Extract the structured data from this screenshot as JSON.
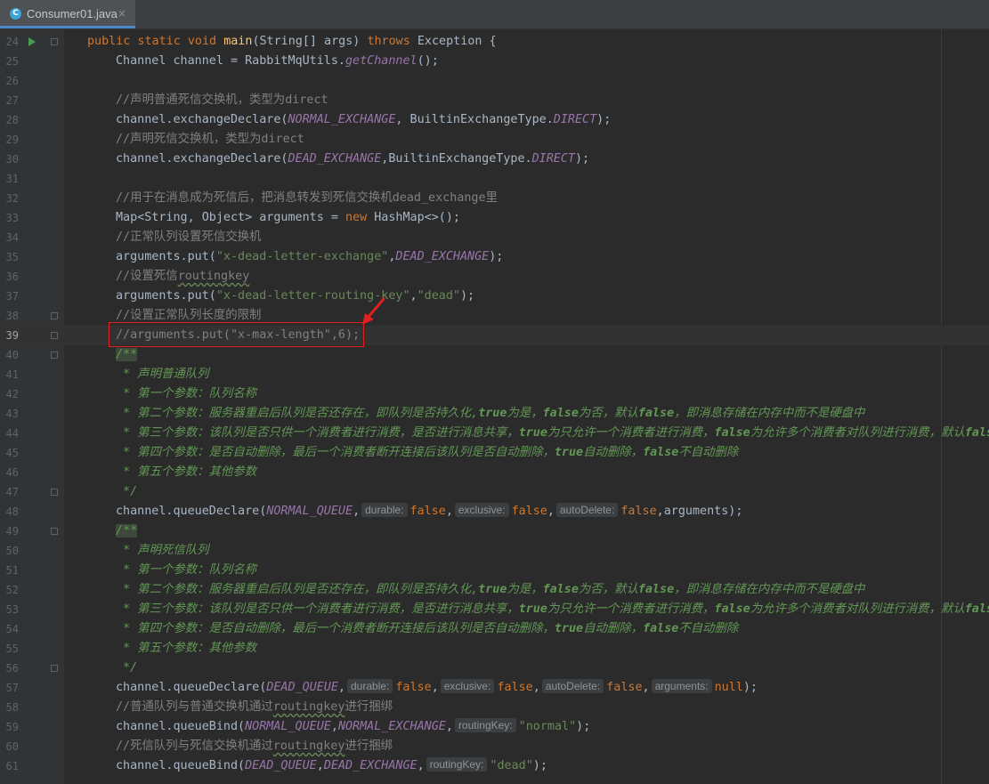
{
  "tab": {
    "icon": "java-class-icon",
    "icon_letter": "C",
    "filename": "Consumer01.java",
    "close": "×"
  },
  "editor": {
    "current_line": 39,
    "lines": [
      {
        "n": 24,
        "run": true,
        "fold": true,
        "indent": 0,
        "t": [
          [
            "kw",
            "public static void "
          ],
          [
            "fn",
            "main"
          ],
          [
            "",
            "(String[] args) "
          ],
          [
            "kw",
            "throws "
          ],
          [
            "",
            "Exception {"
          ]
        ]
      },
      {
        "n": 25,
        "indent": 1,
        "t": [
          [
            "",
            "Channel channel = RabbitMqUtils."
          ],
          [
            "st",
            "getChannel"
          ],
          [
            "",
            "();"
          ]
        ]
      },
      {
        "n": 26,
        "indent": 1,
        "t": []
      },
      {
        "n": 27,
        "indent": 1,
        "t": [
          [
            "cmt",
            "//声明普通死信交换机，类型为direct"
          ]
        ]
      },
      {
        "n": 28,
        "indent": 1,
        "t": [
          [
            "",
            "channel.exchangeDeclare("
          ],
          [
            "cst",
            "NORMAL_EXCHANGE"
          ],
          [
            "",
            ", BuiltinExchangeType."
          ],
          [
            "cst",
            "DIRECT"
          ],
          [
            "",
            ");"
          ]
        ]
      },
      {
        "n": 29,
        "indent": 1,
        "t": [
          [
            "cmt",
            "//声明死信交换机，类型为direct"
          ]
        ]
      },
      {
        "n": 30,
        "indent": 1,
        "t": [
          [
            "",
            "channel.exchangeDeclare("
          ],
          [
            "cst",
            "DEAD_EXCHANGE"
          ],
          [
            "",
            ",BuiltinExchangeType."
          ],
          [
            "cst",
            "DIRECT"
          ],
          [
            "",
            ");"
          ]
        ]
      },
      {
        "n": 31,
        "indent": 1,
        "t": []
      },
      {
        "n": 32,
        "indent": 1,
        "t": [
          [
            "cmt",
            "//用于在消息成为死信后，把消息转发到死信交换机dead_exchange里"
          ]
        ]
      },
      {
        "n": 33,
        "indent": 1,
        "t": [
          [
            "",
            "Map<String, Object> arguments = "
          ],
          [
            "kw",
            "new "
          ],
          [
            "",
            "HashMap<>();"
          ]
        ]
      },
      {
        "n": 34,
        "indent": 1,
        "t": [
          [
            "cmt",
            "//正常队列设置死信交换机"
          ]
        ]
      },
      {
        "n": 35,
        "indent": 1,
        "t": [
          [
            "",
            "arguments.put("
          ],
          [
            "str",
            "\"x-dead-letter-exchange\""
          ],
          [
            "",
            ","
          ],
          [
            "cst",
            "DEAD_EXCHANGE"
          ],
          [
            "",
            ");"
          ]
        ]
      },
      {
        "n": 36,
        "indent": 1,
        "t": [
          [
            "cmt",
            "//设置死信"
          ],
          [
            "cmt ul",
            "routingkey"
          ]
        ]
      },
      {
        "n": 37,
        "indent": 1,
        "t": [
          [
            "",
            "arguments.put("
          ],
          [
            "str",
            "\"x-dead-letter-routing-key\""
          ],
          [
            "",
            ","
          ],
          [
            "str",
            "\"dead\""
          ],
          [
            "",
            ");"
          ]
        ]
      },
      {
        "n": 38,
        "fold": true,
        "indent": 1,
        "t": [
          [
            "cmt",
            "//设置正常队列长度的限制"
          ]
        ]
      },
      {
        "n": 39,
        "fold": true,
        "indent": 1,
        "t": [
          [
            "cmt",
            "//arguments.put(\"x-max-length\",6);"
          ]
        ]
      },
      {
        "n": 40,
        "fold": true,
        "indent": 1,
        "t": [
          [
            "doc docstart",
            "/**"
          ]
        ]
      },
      {
        "n": 41,
        "indent": 1,
        "t": [
          [
            "doc",
            " * 声明普通队列"
          ]
        ]
      },
      {
        "n": 42,
        "indent": 1,
        "t": [
          [
            "doc",
            " * 第一个参数：队列名称"
          ]
        ]
      },
      {
        "n": 43,
        "indent": 1,
        "t": [
          [
            "doc",
            " * 第二个参数：服务器重启后队列是否还存在，即队列是否持久化,"
          ],
          [
            "doc b",
            "true"
          ],
          [
            "doc",
            "为是，"
          ],
          [
            "doc b",
            "false"
          ],
          [
            "doc",
            "为否，默认"
          ],
          [
            "doc b",
            "false"
          ],
          [
            "doc",
            "，即消息存储在内存中而不是硬盘中"
          ]
        ]
      },
      {
        "n": 44,
        "indent": 1,
        "t": [
          [
            "doc",
            " * 第三个参数：该队列是否只供一个消费者进行消费，是否进行消息共享，"
          ],
          [
            "doc b",
            "true"
          ],
          [
            "doc",
            "为只允许一个消费者进行消费，"
          ],
          [
            "doc b",
            "false"
          ],
          [
            "doc",
            "为允许多个消费者对队列进行消费，默认"
          ],
          [
            "doc b",
            "false"
          ]
        ]
      },
      {
        "n": 45,
        "indent": 1,
        "t": [
          [
            "doc",
            " * 第四个参数：是否自动删除，最后一个消费者断开连接后该队列是否自动删除，"
          ],
          [
            "doc b",
            "true"
          ],
          [
            "doc",
            "自动删除，"
          ],
          [
            "doc b",
            "false"
          ],
          [
            "doc",
            "不自动删除"
          ]
        ]
      },
      {
        "n": 46,
        "indent": 1,
        "t": [
          [
            "doc",
            " * 第五个参数：其他参数"
          ]
        ]
      },
      {
        "n": 47,
        "fold": true,
        "indent": 1,
        "t": [
          [
            "doc",
            " */"
          ]
        ]
      },
      {
        "n": 48,
        "indent": 1,
        "t": [
          [
            "",
            "channel.queueDeclare("
          ],
          [
            "cst",
            "NORMAL_QUEUE"
          ],
          [
            "",
            ","
          ],
          [
            "hint",
            "durable:"
          ],
          [
            "kw",
            "false"
          ],
          [
            "",
            ","
          ],
          [
            "hint",
            "exclusive:"
          ],
          [
            "kw",
            "false"
          ],
          [
            "",
            ","
          ],
          [
            "hint",
            "autoDelete:"
          ],
          [
            "kw",
            "false"
          ],
          [
            "",
            ",arguments);"
          ]
        ]
      },
      {
        "n": 49,
        "fold": true,
        "indent": 1,
        "t": [
          [
            "doc docstart",
            "/**"
          ]
        ]
      },
      {
        "n": 50,
        "indent": 1,
        "t": [
          [
            "doc",
            " * 声明死信队列"
          ]
        ]
      },
      {
        "n": 51,
        "indent": 1,
        "t": [
          [
            "doc",
            " * 第一个参数：队列名称"
          ]
        ]
      },
      {
        "n": 52,
        "indent": 1,
        "t": [
          [
            "doc",
            " * 第二个参数：服务器重启后队列是否还存在，即队列是否持久化,"
          ],
          [
            "doc b",
            "true"
          ],
          [
            "doc",
            "为是，"
          ],
          [
            "doc b",
            "false"
          ],
          [
            "doc",
            "为否，默认"
          ],
          [
            "doc b",
            "false"
          ],
          [
            "doc",
            "，即消息存储在内存中而不是硬盘中"
          ]
        ]
      },
      {
        "n": 53,
        "indent": 1,
        "t": [
          [
            "doc",
            " * 第三个参数：该队列是否只供一个消费者进行消费，是否进行消息共享，"
          ],
          [
            "doc b",
            "true"
          ],
          [
            "doc",
            "为只允许一个消费者进行消费，"
          ],
          [
            "doc b",
            "false"
          ],
          [
            "doc",
            "为允许多个消费者对队列进行消费，默认"
          ],
          [
            "doc b",
            "false"
          ]
        ]
      },
      {
        "n": 54,
        "indent": 1,
        "t": [
          [
            "doc",
            " * 第四个参数：是否自动删除，最后一个消费者断开连接后该队列是否自动删除，"
          ],
          [
            "doc b",
            "true"
          ],
          [
            "doc",
            "自动删除，"
          ],
          [
            "doc b",
            "false"
          ],
          [
            "doc",
            "不自动删除"
          ]
        ]
      },
      {
        "n": 55,
        "indent": 1,
        "t": [
          [
            "doc",
            " * 第五个参数：其他参数"
          ]
        ]
      },
      {
        "n": 56,
        "fold": true,
        "indent": 1,
        "t": [
          [
            "doc",
            " */"
          ]
        ]
      },
      {
        "n": 57,
        "indent": 1,
        "t": [
          [
            "",
            "channel.queueDeclare("
          ],
          [
            "cst",
            "DEAD_QUEUE"
          ],
          [
            "",
            ","
          ],
          [
            "hint",
            "durable:"
          ],
          [
            "kw",
            "false"
          ],
          [
            "",
            ","
          ],
          [
            "hint",
            "exclusive:"
          ],
          [
            "kw",
            "false"
          ],
          [
            "",
            ","
          ],
          [
            "hint",
            "autoDelete:"
          ],
          [
            "kw",
            "false"
          ],
          [
            "",
            ","
          ],
          [
            "hint",
            "arguments:"
          ],
          [
            "kw",
            "null"
          ],
          [
            "",
            ");"
          ]
        ]
      },
      {
        "n": 58,
        "indent": 1,
        "t": [
          [
            "cmt",
            "//普通队列与普通交换机通过"
          ],
          [
            "cmt ul",
            "routingkey"
          ],
          [
            "cmt",
            "进行捆绑"
          ]
        ]
      },
      {
        "n": 59,
        "indent": 1,
        "t": [
          [
            "",
            "channel.queueBind("
          ],
          [
            "cst",
            "NORMAL_QUEUE"
          ],
          [
            "",
            ","
          ],
          [
            "cst",
            "NORMAL_EXCHANGE"
          ],
          [
            "",
            ","
          ],
          [
            "hint",
            "routingKey:"
          ],
          [
            "str",
            "\"normal\""
          ],
          [
            "",
            ");"
          ]
        ]
      },
      {
        "n": 60,
        "indent": 1,
        "t": [
          [
            "cmt",
            "//死信队列与死信交换机通过"
          ],
          [
            "cmt ul",
            "routingkey"
          ],
          [
            "cmt",
            "进行捆绑"
          ]
        ]
      },
      {
        "n": 61,
        "indent": 1,
        "t": [
          [
            "",
            "channel.queueBind("
          ],
          [
            "cst",
            "DEAD_QUEUE"
          ],
          [
            "",
            ","
          ],
          [
            "cst",
            "DEAD_EXCHANGE"
          ],
          [
            "",
            ","
          ],
          [
            "hint",
            "routingKey:"
          ],
          [
            "str",
            "\"dead\""
          ],
          [
            "",
            ");"
          ]
        ]
      }
    ]
  },
  "annotation": {
    "highlight_line": 39,
    "color": "#e02020"
  }
}
